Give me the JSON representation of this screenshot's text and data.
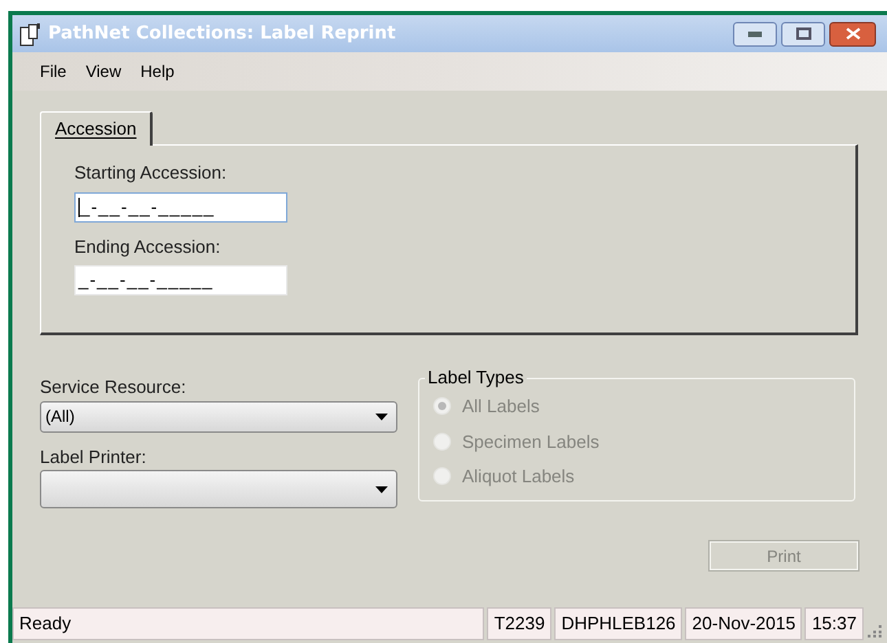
{
  "window": {
    "title": "PathNet Collections: Label Reprint"
  },
  "menu": [
    "File",
    "View",
    "Help"
  ],
  "tabs": [
    {
      "label": "Accession",
      "selected": true
    }
  ],
  "accession": [
    {
      "label": "Starting Accession:",
      "value": "_-__-__-_____",
      "focused": true
    },
    {
      "label": "Ending Accession:",
      "value": "_-__-__-_____",
      "focused": false
    }
  ],
  "dropdowns": [
    {
      "label": "Service Resource:",
      "value": "(All)"
    },
    {
      "label": "Label Printer:"
    }
  ],
  "label_types": {
    "title": "Label Types",
    "disabled": true,
    "options": [
      {
        "label": "All Labels",
        "selected": true
      },
      {
        "label": "Specimen Labels",
        "selected": false
      },
      {
        "label": "Aliquot Labels",
        "selected": false
      }
    ]
  },
  "print_button": {
    "label": "Print",
    "disabled": true
  },
  "status_bar": [
    "Ready",
    "T2239",
    "DHPHLEB126",
    "20-Nov-2015",
    "15:37"
  ]
}
